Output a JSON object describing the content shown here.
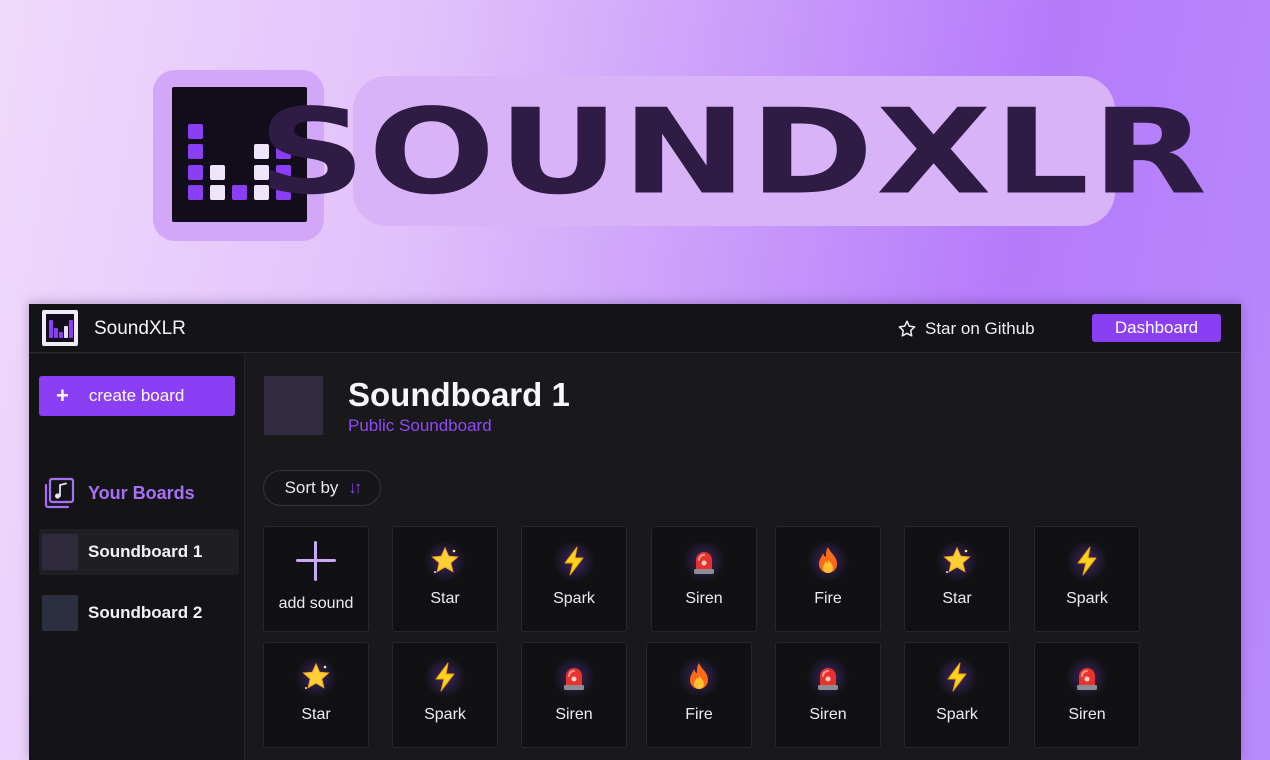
{
  "hero": {
    "title": "SOUNDXLR"
  },
  "topbar": {
    "app_name": "SoundXLR",
    "github_label": "Star on Github",
    "dashboard_label": "Dashboard"
  },
  "sidebar": {
    "create_label": "create board",
    "section_title": "Your Boards",
    "boards": [
      {
        "label": "Soundboard 1",
        "active": true,
        "color": "#302a3d"
      },
      {
        "label": "Soundboard 2",
        "active": false,
        "color": "#2b2f3f"
      }
    ]
  },
  "main": {
    "title": "Soundboard 1",
    "subtitle": "Public Soundboard",
    "sort_label": "Sort by",
    "add_label": "add sound",
    "tiles": [
      {
        "label": "Star",
        "icon": "star"
      },
      {
        "label": "Spark",
        "icon": "lightning"
      },
      {
        "label": "Siren",
        "icon": "siren"
      },
      {
        "label": "Fire",
        "icon": "fire"
      },
      {
        "label": "Star",
        "icon": "star"
      },
      {
        "label": "Spark",
        "icon": "lightning"
      },
      {
        "label": "Star",
        "icon": "star"
      },
      {
        "label": "Spark",
        "icon": "lightning"
      },
      {
        "label": "Siren",
        "icon": "siren"
      },
      {
        "label": "Fire",
        "icon": "fire"
      },
      {
        "label": "Siren",
        "icon": "siren"
      },
      {
        "label": "Spark",
        "icon": "lightning"
      },
      {
        "label": "Siren",
        "icon": "siren"
      }
    ]
  },
  "colors": {
    "accent": "#8b3ff5",
    "accent_text": "#9049f6",
    "background_dark": "#19191c"
  }
}
